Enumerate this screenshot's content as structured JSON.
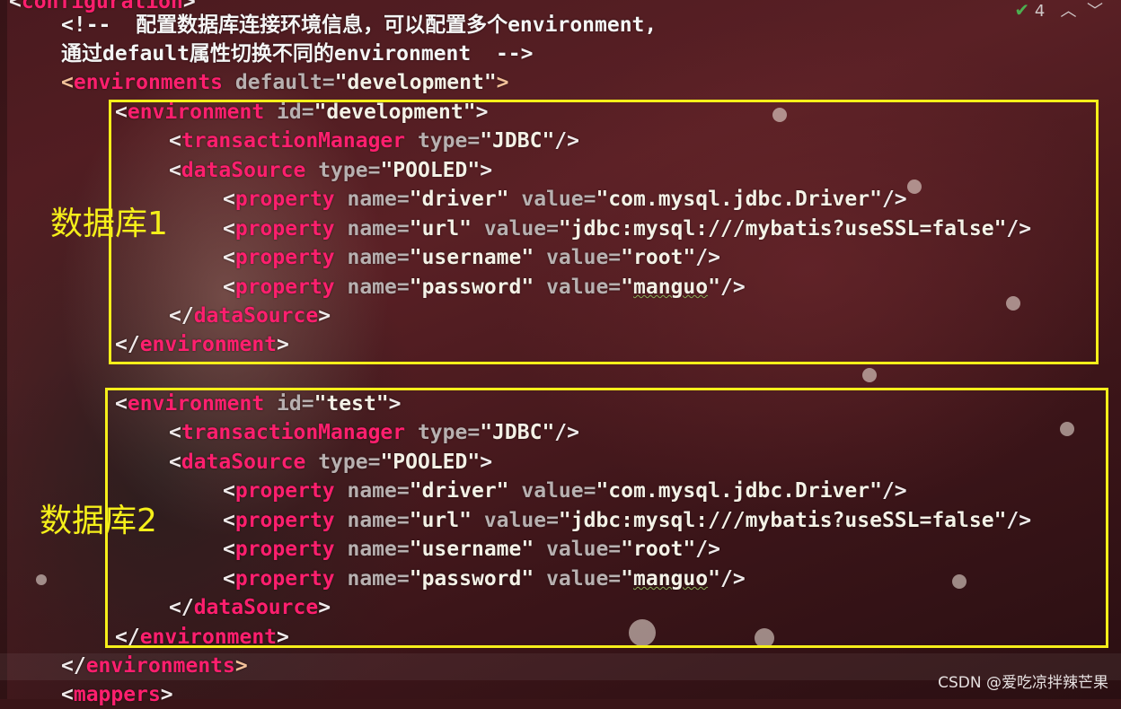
{
  "editor": {
    "status": {
      "check_icon": "double-check-icon",
      "count": "4",
      "up_icon": "chevron-up-icon",
      "down_icon": "chevron-down-icon"
    },
    "lines": {
      "l0_tag": "configuration",
      "l1_comment": "<!--  配置数据库连接环境信息，可以配置多个environment,",
      "l2_comment": "通过default属性切换不同的environment  -->",
      "l3_open": "<",
      "l3_tag": "environments",
      "l3_attr": " default=",
      "l3_val": "\"development\"",
      "l3_close": ">",
      "env1_tag": "environment",
      "env1_attr": " id=",
      "env1_val": "\"development\"",
      "tm_tag": "transactionManager",
      "tm_attr": " type=",
      "tm_val": "\"JDBC\"",
      "ds_tag": "dataSource",
      "ds_attr": " type=",
      "ds_val": "\"POOLED\"",
      "prop_tag": "property",
      "name_attr": " name=",
      "value_attr": " value=",
      "p1_name": "\"driver\"",
      "p1_value": "\"com.mysql.jdbc.Driver\"",
      "p2_name": "\"url\"",
      "p2_value": "\"jdbc:mysql:///mybatis?useSSL=false\"",
      "p3_name": "\"username\"",
      "p3_value": "\"root\"",
      "p4_name": "\"password\"",
      "p4_value_q": "\"",
      "p4_value": "manguo",
      "env2_val": "\"test\"",
      "mappers_tag": "mappers"
    },
    "annotations": {
      "db1": "数据库1",
      "db2": "数据库2"
    },
    "colors": {
      "tag": "#ff1f6e",
      "attr": "#b8b0b0",
      "string": "#f4f1e6",
      "box": "#f5ef1a"
    }
  },
  "watermark": "CSDN @爱吃凉拌辣芒果"
}
